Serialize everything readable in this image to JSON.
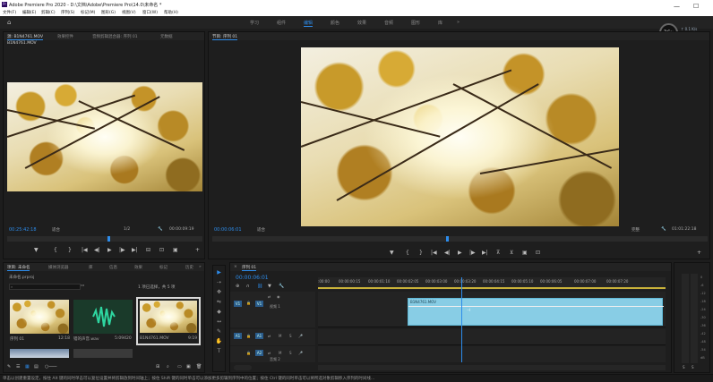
{
  "titlebar": {
    "title": "Adobe Premiere Pro 2020 - D:\\文档\\Adobe\\Premiere Pro\\14.0\\未命名 *",
    "logo": "Pr"
  },
  "window_controls": {
    "minimize": "—",
    "maximize": "☐"
  },
  "menu": [
    "文件(F)",
    "编辑(E)",
    "剪辑(C)",
    "序列(S)",
    "标记(M)",
    "图形(G)",
    "视图(V)",
    "窗口(W)",
    "帮助(H)"
  ],
  "workspaces": {
    "items": [
      "学习",
      "组件",
      "编辑",
      "颜色",
      "效果",
      "音频",
      "图形",
      "库"
    ],
    "active": "编辑",
    "more": "»"
  },
  "performance": {
    "percent": "36",
    "unit": "%",
    "up": "0.1",
    "up_unit": "K/s",
    "down": "0",
    "down_unit": "K/s"
  },
  "source_panel": {
    "tabs": [
      "源: B1N4761.MOV",
      "效果控件",
      "音频剪辑混合器: 序列 01",
      "元数据"
    ],
    "clip_name": "B1N4761.MOV",
    "timecode": "00:25:42:18",
    "fit": "适合",
    "resolution": "1/2",
    "duration": "00:00:09:19"
  },
  "program_panel": {
    "tab": "节目: 序列 01",
    "timecode": "00:00:06:01",
    "fit": "适合",
    "resolution": "完整",
    "duration": "01:01:22:18"
  },
  "transport_glyphs": {
    "marker": "▼",
    "in": "{",
    "out": "}",
    "goto_in": "|◀",
    "step_back": "◀|",
    "play": "▶",
    "step_fwd": "|▶",
    "goto_out": "▶|",
    "insert": "⊟",
    "overwrite": "⊡",
    "export": "📷",
    "add": "+",
    "lift": "⊼",
    "extract": "⊻",
    "compare": "▣"
  },
  "project_panel": {
    "tabs": [
      "项目: 未命名",
      "媒体浏览器",
      "库",
      "信息",
      "效果",
      "标记",
      "历史"
    ],
    "more": "»",
    "file": "未命名.prproj",
    "selection": "1 项已选择，共 5 项",
    "items": [
      {
        "name": "序列 01",
        "duration": "12:18"
      },
      {
        "name": "错的声音.wav",
        "duration": "5:09420"
      },
      {
        "name": "B1N4761.MOV",
        "duration": "9:19"
      }
    ]
  },
  "timeline_panel": {
    "tab": "序列 01",
    "timecode": "00:00:06:01",
    "ruler": [
      ":00:00",
      "00:00:00:15",
      "00:00:01:10",
      "00:00:02:05",
      "00:00:03:00",
      "00:00:03:20",
      "00:00:04:15",
      "00:00:05:10",
      "00:00:06:05",
      "00:00:07:00",
      "00:00:07:20"
    ],
    "tracks": [
      {
        "id": "V1",
        "name": "视频 1"
      },
      {
        "id": "A1",
        "name": "音频 1"
      },
      {
        "id": "A2",
        "name": "音频 2"
      }
    ],
    "clip": {
      "name": "B1N4761.MOV",
      "color": "#8ed7f0"
    },
    "toggle_m": "M",
    "toggle_s": "S",
    "mic": "🎤",
    "eye": "◉",
    "lock": "🔒",
    "source_lbl": "V1",
    "source_a_lbl": "A1"
  },
  "audio_meter": {
    "labels": [
      "0",
      "-6",
      "-12",
      "-18",
      "-24",
      "-30",
      "-36",
      "-42",
      "-48",
      "-54",
      "dB"
    ],
    "s": "S",
    "s2": "S"
  },
  "tools": [
    "▶",
    "⇢",
    "✥",
    "⇋",
    "◆",
    "↔",
    "✎",
    "✋",
    "T"
  ],
  "status_text": "单击以创建重置设定，按住 Alt 键的同时单击可以复位设置并将剪辑放到时间轴上；按住 Shift 键的同时单击可以添加更多剪辑到序列中的位置；按住 Ctrl 键的同时单击可以将所选对象剪辑移入序列的时间线..."
}
